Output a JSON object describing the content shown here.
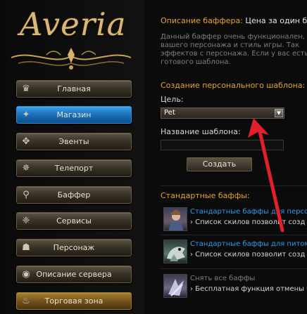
{
  "logo": {
    "text": "Averia"
  },
  "menu": [
    {
      "label": "Главная",
      "icon": "crown-icon",
      "glyph": "♛"
    },
    {
      "label": "Магазин",
      "icon": "shop-icon",
      "glyph": "✦"
    },
    {
      "label": "Эвенты",
      "icon": "emblem-icon",
      "glyph": "✥"
    },
    {
      "label": "Телепорт",
      "icon": "teleport-icon",
      "glyph": "✵"
    },
    {
      "label": "Баффер",
      "icon": "wand-icon",
      "glyph": "⚲"
    },
    {
      "label": "Сервисы",
      "icon": "gear-icon",
      "glyph": "❈"
    },
    {
      "label": "Персонаж",
      "icon": "character-icon",
      "glyph": "☗"
    },
    {
      "label": "Описание сервера",
      "icon": "eye-icon",
      "glyph": "◉"
    },
    {
      "label": "Торговая зона",
      "icon": "fire-icon",
      "glyph": "♨"
    }
  ],
  "buffer": {
    "title_prefix": "Описание баффера:",
    "title_text": " Цена за один баф",
    "desc_lines": [
      "Данный баффер очень функционален,",
      "вашего персонажа и стиль игры. Так ",
      "эффектов с персонажа. Если у вас есть",
      "готового шаблона."
    ]
  },
  "template": {
    "heading": "Создание персонального шаблона:",
    "target_label": "Цель:",
    "target_value": "Pet",
    "name_label": "Название шаблона:",
    "name_value": "",
    "create_button": "Создать"
  },
  "standard": {
    "heading": "Стандартные баффы:",
    "items": [
      {
        "title": "Стандартные баффы для персо",
        "desc": "› Список скилов позволит созд",
        "link": true
      },
      {
        "title": "Стандартные баффы для питом",
        "desc": "› Список скилов позволит созд",
        "link": true
      },
      {
        "title": "Снять все баффы",
        "desc": "› Бесплатная функция отмены б",
        "link": false
      }
    ]
  },
  "colors": {
    "accent_orange": "#e8a32c",
    "link_blue": "#2e9ae6",
    "annotation_arrow": "#e0202a"
  }
}
